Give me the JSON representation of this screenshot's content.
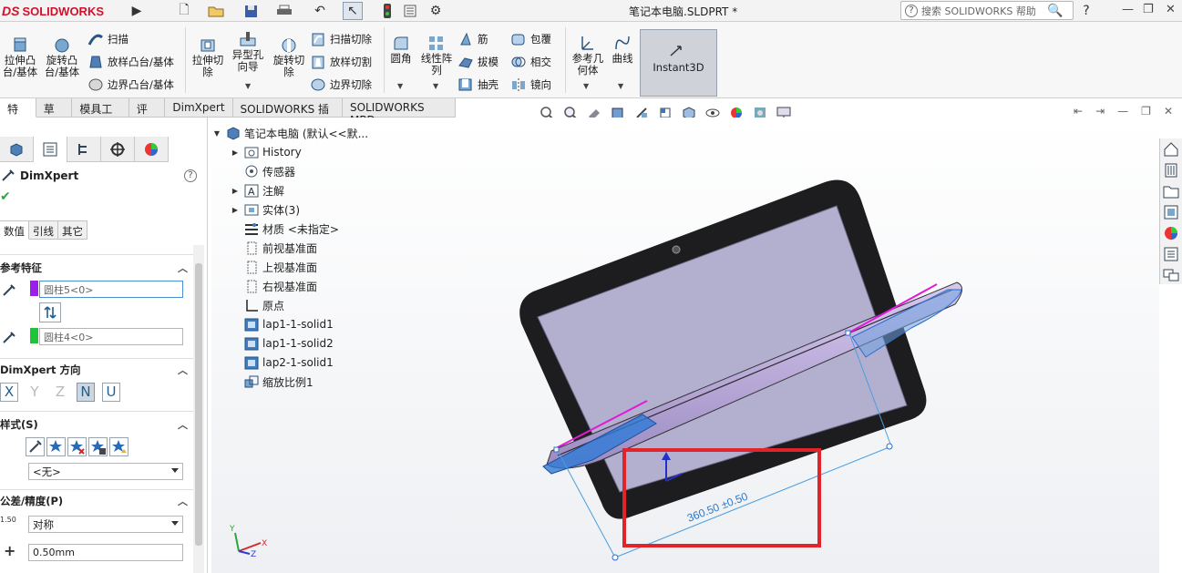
{
  "app": {
    "logo_ds": "DS",
    "logo_text": "SOLIDWORKS",
    "doc_title": "笔记本电脑.SLDPRT *"
  },
  "help_search": {
    "placeholder": "搜索 SOLIDWORKS 帮助"
  },
  "ribbon": {
    "extrude_boss": "拉伸凸\n台/基体",
    "revolve_boss": "旋转凸\n台/基体",
    "sweep": "扫描",
    "loft_boss": "放样凸台/基体",
    "boundary_boss": "边界凸台/基体",
    "extrude_cut": "拉伸切\n除",
    "hole_wizard": "异型孔\n向导",
    "revolve_cut": "旋转切\n除",
    "swept_cut": "扫描切除",
    "lofted_cut": "放样切割",
    "boundary_cut": "边界切除",
    "fillet": "圆角",
    "linear_pattern": "线性阵\n列",
    "rib": "筋",
    "draft": "拔模",
    "shell": "抽壳",
    "wrap": "包覆",
    "intersect": "相交",
    "mirror": "镜向",
    "ref_geometry": "参考几\n何体",
    "curves": "曲线",
    "instant3d": "Instant3D"
  },
  "tabs": [
    "特征",
    "草图",
    "模具工具",
    "评估",
    "DimXpert",
    "SOLIDWORKS 插件",
    "SOLIDWORKS MBD"
  ],
  "panel": {
    "title": "DimXpert",
    "subtabs": [
      "数值",
      "引线",
      "其它"
    ],
    "ref_feature_header": "参考特征",
    "ref1": "圆柱5<0>",
    "ref2": "圆柱4<0>",
    "dir_header": "DimXpert 方向",
    "dir_buttons": [
      "X",
      "Y",
      "Z",
      "N",
      "U"
    ],
    "style_header": "样式(S)",
    "style_value": "<无>",
    "tol_header": "公差/精度(P)",
    "tol_type": "对称",
    "tol_icon_text": "1.50",
    "tol_value": "0.50mm",
    "colors": {
      "ref1": "#9b1fe8",
      "ref2": "#1fc43a"
    }
  },
  "tree": {
    "root": "笔记本电脑  (默认<<默...",
    "items": [
      "History",
      "传感器",
      "注解",
      "实体(3)",
      "材质 <未指定>",
      "前视基准面",
      "上视基准面",
      "右视基准面",
      "原点",
      "lap1-1-solid1",
      "lap1-1-solid2",
      "lap2-1-solid1",
      "缩放比例1"
    ]
  },
  "viewport": {
    "dimension_text": "360.50 ±0.50",
    "triad_x": "X",
    "triad_y": "Y",
    "triad_z": "Z"
  }
}
